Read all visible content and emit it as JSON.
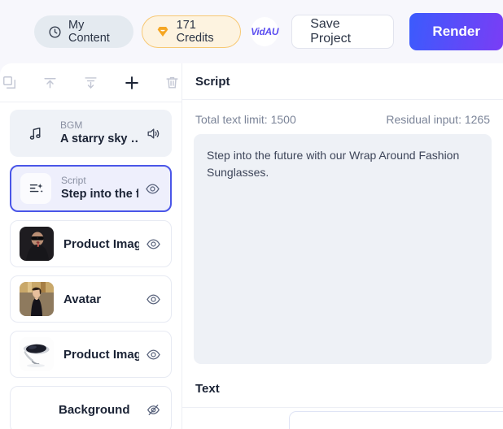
{
  "header": {
    "my_content_label": "My Content",
    "credits_label": "171 Credits",
    "logo_text": "VidAU",
    "save_label": "Save Project",
    "render_label": "Render",
    "accent_render_start": "#3b5bfd",
    "accent_render_end": "#7a3df5",
    "credits_border": "#f7c873"
  },
  "toolbar": {
    "icons": [
      {
        "name": "duplicate-icon"
      },
      {
        "name": "move-up-icon"
      },
      {
        "name": "move-down-icon"
      },
      {
        "name": "add-icon"
      },
      {
        "name": "delete-icon"
      }
    ]
  },
  "layers": [
    {
      "sub": "BGM",
      "title": "A starry sky …",
      "kind": "bgm",
      "icon": "music-note-icon",
      "action_icon": "speaker-icon"
    },
    {
      "sub": "Script",
      "title": "Step into the f…",
      "kind": "script",
      "icon": "script-icon",
      "action_icon": "eye-icon",
      "selected": true
    },
    {
      "sub": "",
      "title": "Product Image",
      "kind": "product-image-1",
      "icon": "thumbnail-sunglasses-model",
      "action_icon": "eye-icon"
    },
    {
      "sub": "",
      "title": "Avatar",
      "kind": "avatar",
      "icon": "thumbnail-avatar-woman",
      "action_icon": "eye-icon"
    },
    {
      "sub": "",
      "title": "Product Image",
      "kind": "product-image-2",
      "icon": "thumbnail-sunglasses-product",
      "action_icon": "eye-icon"
    },
    {
      "sub": "",
      "title": "Background",
      "kind": "background",
      "icon": "none",
      "action_icon": "eye-off-icon"
    }
  ],
  "script_panel": {
    "title": "Script",
    "total_limit_label": "Total text limit: 1500",
    "residual_label": "Residual input: 1265",
    "script_text": "Step into the future with our Wrap Around Fashion Sunglasses."
  },
  "text_panel": {
    "title": "Text"
  }
}
